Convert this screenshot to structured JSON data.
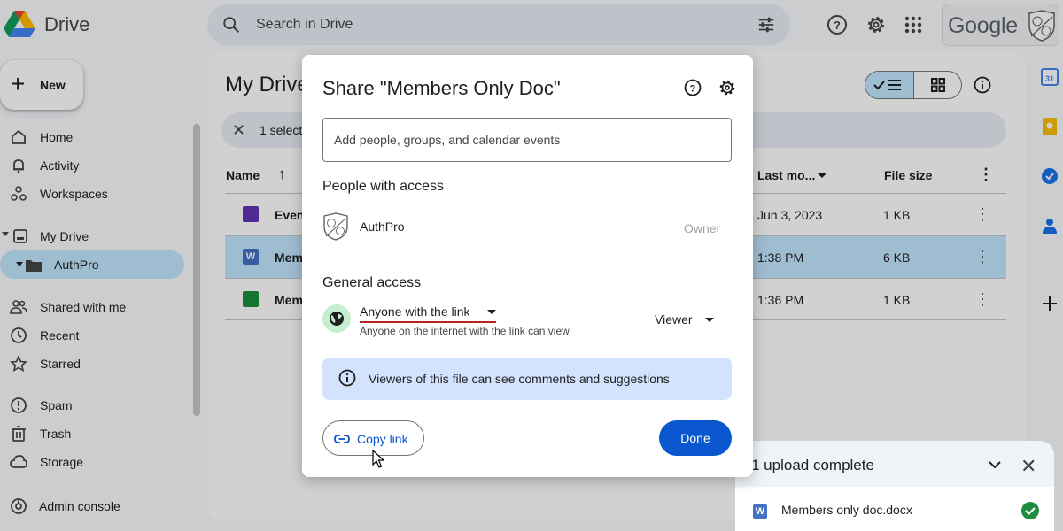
{
  "app": {
    "title": "Drive"
  },
  "search": {
    "placeholder": "Search in Drive"
  },
  "account": {
    "label": "Google"
  },
  "sidebar": {
    "new_label": "New",
    "items": [
      {
        "label": "Home",
        "icon": "home-icon"
      },
      {
        "label": "Activity",
        "icon": "bell-icon"
      },
      {
        "label": "Workspaces",
        "icon": "workspaces-icon"
      },
      {
        "label": "My Drive",
        "icon": "my-drive-icon"
      },
      {
        "label": "AuthPro",
        "icon": "folder-icon"
      },
      {
        "label": "Shared with me",
        "icon": "people-icon"
      },
      {
        "label": "Recent",
        "icon": "clock-icon"
      },
      {
        "label": "Starred",
        "icon": "star-icon"
      },
      {
        "label": "Spam",
        "icon": "spam-icon"
      },
      {
        "label": "Trash",
        "icon": "trash-icon"
      },
      {
        "label": "Storage",
        "icon": "cloud-icon"
      },
      {
        "label": "Admin console",
        "icon": "admin-icon"
      }
    ]
  },
  "main": {
    "title": "My Drive",
    "selection_text": "1 select",
    "columns": {
      "name": "Name",
      "modified": "Last mo...",
      "size": "File size"
    },
    "rows": [
      {
        "name": "Even",
        "modified": "Jun 3, 2023",
        "size": "1 KB",
        "type": "forms",
        "color": "#5e35b1"
      },
      {
        "name": "Mem",
        "modified": "1:38 PM",
        "size": "6 KB",
        "type": "word",
        "color": "#4472c4"
      },
      {
        "name": "Mem",
        "modified": "1:36 PM",
        "size": "1 KB",
        "type": "sheets",
        "color": "#1e8e3e"
      }
    ]
  },
  "dialog": {
    "title": "Share \"Members Only Doc\"",
    "add_placeholder": "Add people, groups, and calendar events",
    "people_heading": "People with access",
    "person": {
      "name": "AuthPro",
      "role": "Owner"
    },
    "general_heading": "General access",
    "access_option": "Anyone with the link",
    "access_description": "Anyone on the internet with the link can view",
    "role_option": "Viewer",
    "info_text": "Viewers of this file can see comments and suggestions",
    "copy_link_label": "Copy link",
    "done_label": "Done"
  },
  "upload": {
    "title": "1 upload complete",
    "file_name": "Members only doc.docx"
  },
  "colors": {
    "accent": "#0b57d0",
    "selection": "#c2e7ff",
    "info_bg": "#d3e3fd",
    "underline": "#b3261e",
    "success": "#1e8e3e"
  }
}
